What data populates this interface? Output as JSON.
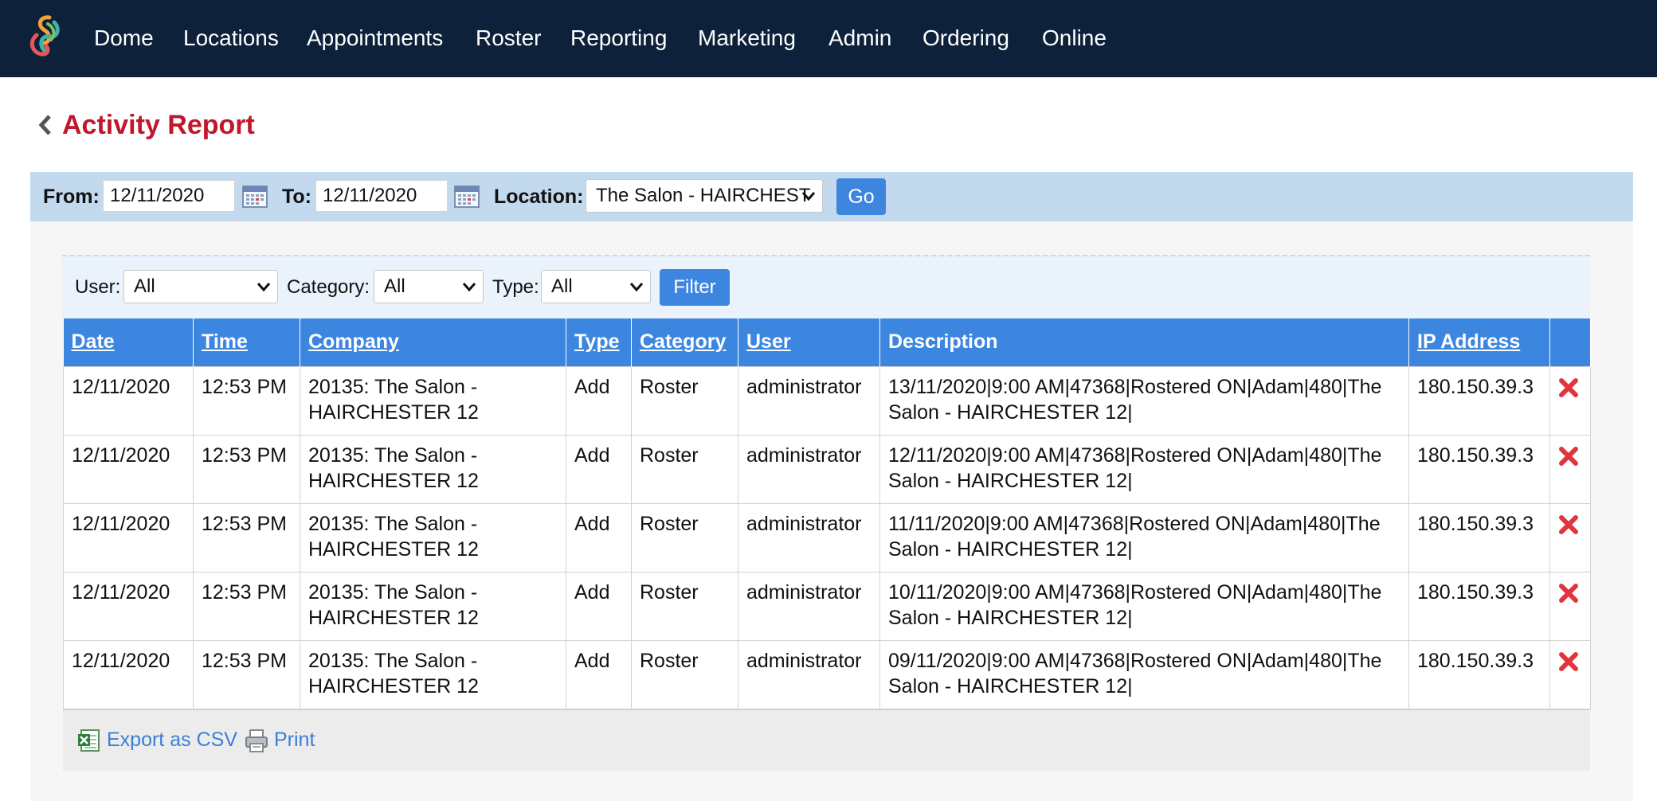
{
  "nav": {
    "items": [
      "Dome",
      "Locations",
      "Appointments",
      "Roster",
      "Reporting",
      "Marketing",
      "Admin",
      "Ordering",
      "Online"
    ],
    "colors": {
      "bar": "#0d223a",
      "text": "#ffffff"
    }
  },
  "page": {
    "title": "Activity Report",
    "title_color": "#c0172b"
  },
  "daterange": {
    "from_label": "From:",
    "from_value": "12/11/2020",
    "to_label": "To:",
    "to_value": "12/11/2020",
    "location_label": "Location:",
    "location_value": "The Salon - HAIRCHEST",
    "go_label": "Go"
  },
  "filters": {
    "user_label": "User:",
    "user_value": "All",
    "category_label": "Category:",
    "category_value": "All",
    "type_label": "Type:",
    "type_value": "All",
    "filter_label": "Filter"
  },
  "table": {
    "headers": [
      "Date",
      "Time",
      "Company",
      "Type",
      "Category",
      "User",
      "Description",
      "IP Address"
    ],
    "rows": [
      {
        "date": "12/11/2020",
        "time": "12:53 PM",
        "company": "20135: The Salon - HAIRCHESTER 12",
        "type": "Add",
        "category": "Roster",
        "user": "administrator",
        "description": "13/11/2020|9:00 AM|47368|Rostered ON|Adam|480|The Salon - HAIRCHESTER 12|",
        "ip": "180.150.39.3"
      },
      {
        "date": "12/11/2020",
        "time": "12:53 PM",
        "company": "20135: The Salon - HAIRCHESTER 12",
        "type": "Add",
        "category": "Roster",
        "user": "administrator",
        "description": "12/11/2020|9:00 AM|47368|Rostered ON|Adam|480|The Salon - HAIRCHESTER 12|",
        "ip": "180.150.39.3"
      },
      {
        "date": "12/11/2020",
        "time": "12:53 PM",
        "company": "20135: The Salon - HAIRCHESTER 12",
        "type": "Add",
        "category": "Roster",
        "user": "administrator",
        "description": "11/11/2020|9:00 AM|47368|Rostered ON|Adam|480|The Salon - HAIRCHESTER 12|",
        "ip": "180.150.39.3"
      },
      {
        "date": "12/11/2020",
        "time": "12:53 PM",
        "company": "20135: The Salon - HAIRCHESTER 12",
        "type": "Add",
        "category": "Roster",
        "user": "administrator",
        "description": "10/11/2020|9:00 AM|47368|Rostered ON|Adam|480|The Salon - HAIRCHESTER 12|",
        "ip": "180.150.39.3"
      },
      {
        "date": "12/11/2020",
        "time": "12:53 PM",
        "company": "20135: The Salon - HAIRCHESTER 12",
        "type": "Add",
        "category": "Roster",
        "user": "administrator",
        "description": "09/11/2020|9:00 AM|47368|Rostered ON|Adam|480|The Salon - HAIRCHESTER 12|",
        "ip": "180.150.39.3"
      }
    ]
  },
  "footer": {
    "export_label": "Export as CSV",
    "print_label": "Print"
  },
  "icons": [
    "app-logo-icon",
    "chevron-left-icon",
    "calendar-icon",
    "chevron-down-icon",
    "delete-x-icon",
    "excel-icon",
    "printer-icon"
  ]
}
